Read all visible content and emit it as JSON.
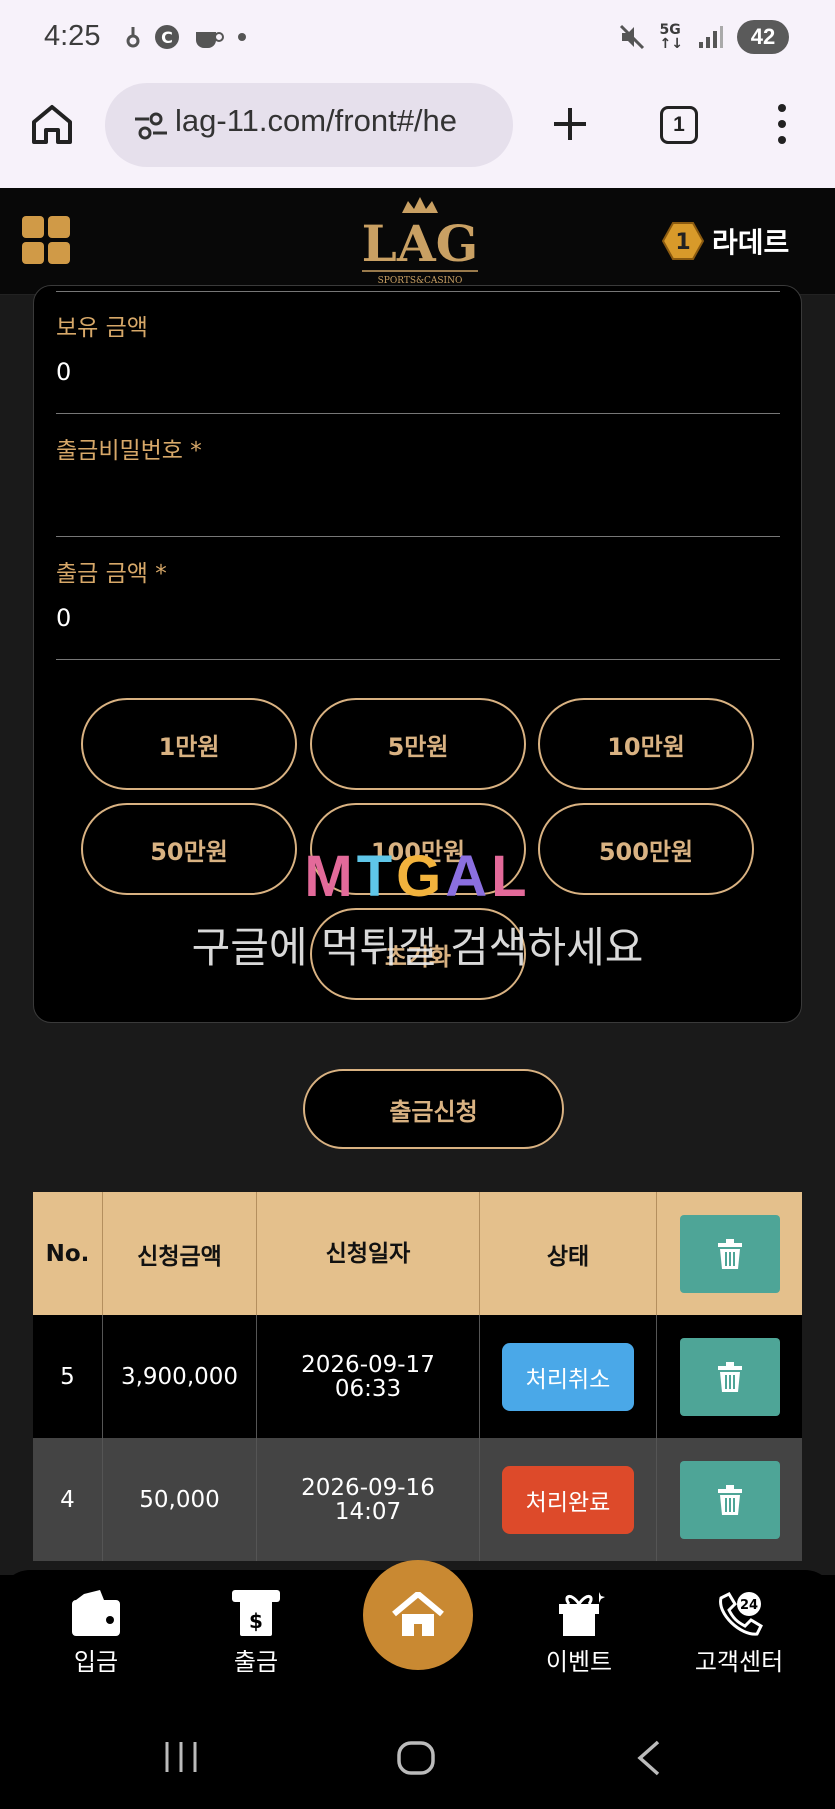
{
  "status_bar": {
    "time": "4:25",
    "network": "5G",
    "battery": "42"
  },
  "browser": {
    "url": "lag-11.com/front#/he",
    "tab_count": "1"
  },
  "header": {
    "logo_text": "LAG",
    "logo_sub": "SPORTS&CASINO",
    "rank_badge": "1",
    "user_name": "라데르"
  },
  "form": {
    "balance_label": "보유 금액",
    "balance_value": "0",
    "password_label": "출금비밀번호 *",
    "password_value": "",
    "amount_label": "출금 금액 *",
    "amount_value": "0",
    "amount_buttons": [
      "1만원",
      "5만원",
      "10만원",
      "50만원",
      "100만원",
      "500만원"
    ],
    "reset_button": "초기화",
    "submit_button": "출금신청"
  },
  "watermark": {
    "logo": "MTGAL",
    "text": "구글에 먹튀갤 검색하세요"
  },
  "table": {
    "headers": {
      "no": "No.",
      "amount": "신청금액",
      "date": "신청일자",
      "status": "상태"
    },
    "rows": [
      {
        "no": "5",
        "amount": "3,900,000",
        "date": "2026-09-17",
        "time": "06:33",
        "status": "처리취소",
        "status_color": "#4aa8e8"
      },
      {
        "no": "4",
        "amount": "50,000",
        "date": "2026-09-16",
        "time": "14:07",
        "status": "처리완료",
        "status_color": "#dd4a2a"
      }
    ]
  },
  "bottom_nav": {
    "deposit": "입금",
    "withdraw": "출금",
    "event": "이벤트",
    "support": "고객센터",
    "support_badge": "24"
  },
  "colors": {
    "gold": "#d9b282",
    "header_gold": "#e4c08c",
    "teal": "#4ea597",
    "home_orange": "#c98932"
  }
}
